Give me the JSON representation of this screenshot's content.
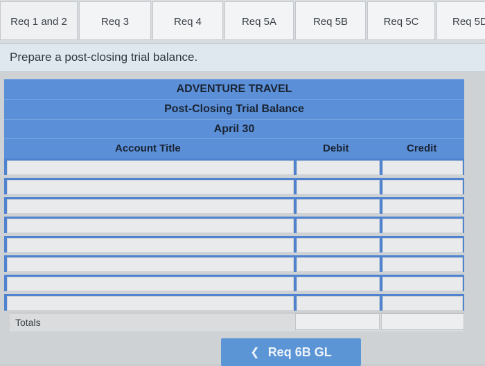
{
  "tabs": [
    {
      "label": "Req 1 and 2"
    },
    {
      "label": "Req 3"
    },
    {
      "label": "Req 4"
    },
    {
      "label": "Req 5A"
    },
    {
      "label": "Req 5B"
    },
    {
      "label": "Req 5C"
    },
    {
      "label": "Req 5D"
    }
  ],
  "instruction": "Prepare a post-closing trial balance.",
  "table": {
    "company": "ADVENTURE TRAVEL",
    "statement": "Post-Closing Trial Balance",
    "date": "April 30",
    "col_account": "Account Title",
    "col_debit": "Debit",
    "col_credit": "Credit",
    "totals_label": "Totals"
  },
  "nav": {
    "prev_icon": "chevron-left-icon",
    "button_label": "Req 6B GL"
  }
}
